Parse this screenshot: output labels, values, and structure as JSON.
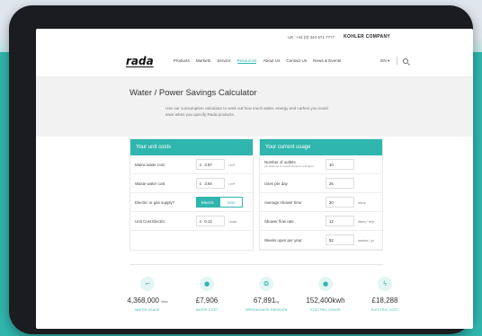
{
  "topbar": {
    "phone": "UK: +44 (0) 344 571 7777",
    "brand": "KOHLER COMPANY"
  },
  "nav": {
    "logo": "rada",
    "menu": [
      "Products",
      "Markets",
      "Service",
      "Resources",
      "About Us",
      "Contact Us",
      "News & Events"
    ],
    "active_index": 3,
    "language": "EN ▾"
  },
  "hero": {
    "title": "Water / Power Savings Calculator",
    "description": "Use our consumption calculator to work out how much water, energy and carbon you could save when you specify Rada products."
  },
  "unit_costs": {
    "title": "Your unit costs",
    "mains_water": {
      "label": "Mains water cost",
      "currency": "£",
      "value": "3.87",
      "unit": "/ m³"
    },
    "waste_water": {
      "label": "Waste water cost",
      "currency": "£",
      "value": "3.94",
      "unit": "/ m³"
    },
    "supply": {
      "label": "Electric or gas supply?",
      "options": [
        "Electric",
        "Gas"
      ],
      "selected": "Electric"
    },
    "unit_cost_electric": {
      "label": "Unit Cost Electric",
      "currency": "£",
      "value": "0.12",
      "unit": "/ kwh"
    }
  },
  "usage": {
    "title": "Your current usage",
    "outlets": {
      "label": "Number of outlets",
      "sublabel": "(of what use is of both showers and taps)",
      "value": "10"
    },
    "uses_per_day": {
      "label": "Uses per day",
      "value": "25"
    },
    "shower_time": {
      "label": "Average shower time",
      "value": "20",
      "unit": "mins"
    },
    "flow_rate": {
      "label": "Shower flow rate",
      "value": "12",
      "unit": "litres / min"
    },
    "weeks_per_year": {
      "label": "Weeks open per year",
      "value": "52",
      "unit": "weeks / yr"
    }
  },
  "results": [
    {
      "icon": "tap-icon",
      "glyph": "⌐",
      "value": "4,368,000",
      "unit": "litres",
      "label": "WATER USAGE"
    },
    {
      "icon": "water-drop-icon",
      "glyph": "●",
      "value": "£7,906",
      "unit": "",
      "label": "WATER COST"
    },
    {
      "icon": "leaf-icon",
      "glyph": "❂",
      "value": "67,891",
      "unit": "kg",
      "label": "GREENHOUSE EMISSION"
    },
    {
      "icon": "lightbulb-icon",
      "glyph": "●",
      "value": "152,400",
      "unit": "kwh",
      "label": "ELECTRIC USAGE"
    },
    {
      "icon": "lightning-icon",
      "glyph": "ϟ",
      "value": "£18,288",
      "unit": "",
      "label": "ELECTRIC COST"
    }
  ],
  "colors": {
    "accent": "#2fb6ae",
    "background": "#2fb6ae",
    "device": "#1b1c20"
  }
}
